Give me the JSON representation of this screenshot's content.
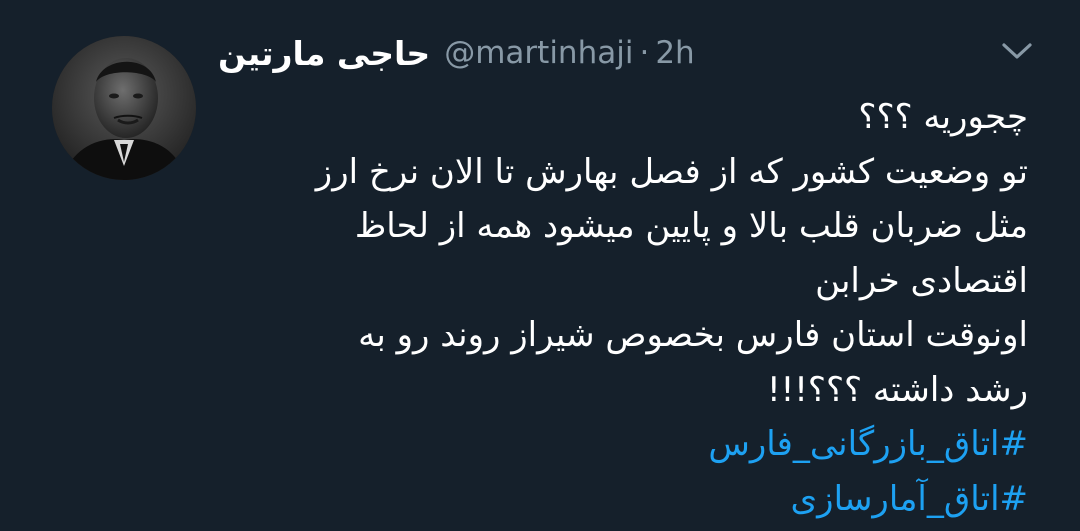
{
  "tweet": {
    "display_name": "حاجی مارتین",
    "handle": "@martinhaji",
    "separator": "·",
    "time": "2h",
    "avatar_icon": "profile-photo",
    "menu_icon": "chevron-down-icon",
    "lines": [
      "چجوریه ؟؟؟",
      "تو وضعیت کشور که از فصل بهارش تا الان نرخ ارز",
      "مثل ضربان قلب بالا و پایین میشود همه از لحاظ",
      "اقتصادی خرابن",
      "اونوقت استان فارس بخصوص شیراز روند رو به",
      "رشد داشته ؟؟؟!!!"
    ],
    "hashtags": [
      "#اتاق_بازرگانی_فارس",
      "#اتاق_آمارسازی"
    ]
  },
  "colors": {
    "background": "#15202b",
    "text": "#ffffff",
    "secondary": "#8899a6",
    "link": "#1da1f2"
  }
}
